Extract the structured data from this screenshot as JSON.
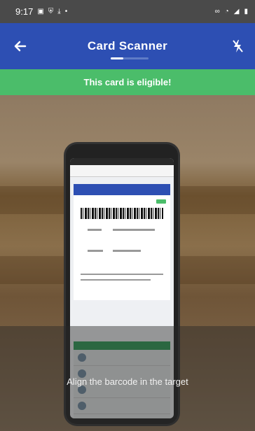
{
  "status_bar": {
    "time": "9:17",
    "left_icons": [
      "image-icon",
      "shield-icon",
      "download-icon",
      "dot-icon"
    ],
    "right_icons": [
      "link-icon",
      "wifi-icon",
      "signal-icon",
      "battery-icon"
    ]
  },
  "app_bar": {
    "title": "Card Scanner",
    "back_icon": "arrow-left-icon",
    "flash_icon": "flash-off-icon"
  },
  "banner": {
    "text": "This card is eligible!",
    "color": "#4bbd6a"
  },
  "camera": {
    "hint": "Align the barcode in the target"
  },
  "colors": {
    "app_bar": "#2d4fb3",
    "status_bar": "#4a4a4a"
  }
}
